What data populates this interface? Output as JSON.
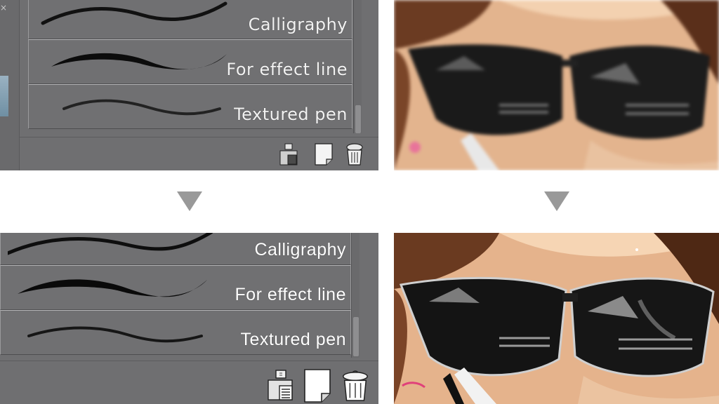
{
  "before_panel": {
    "brushes": [
      {
        "label": "Calligraphy"
      },
      {
        "label": "For effect line"
      },
      {
        "label": "Textured pen"
      }
    ],
    "toolbar": {
      "icons": [
        "brush-settings-icon",
        "new-page-icon",
        "trash-icon"
      ]
    }
  },
  "after_panel": {
    "brushes": [
      {
        "label": "Calligraphy"
      },
      {
        "label": "For effect line"
      },
      {
        "label": "Textured pen"
      }
    ],
    "toolbar": {
      "icons": [
        "brush-settings-icon",
        "new-page-icon",
        "trash-icon"
      ]
    }
  },
  "arrows": [
    "down-arrow",
    "down-arrow"
  ],
  "colors": {
    "panel_bg": "#6f6f71",
    "arrow": "#999999",
    "label": "#ffffff"
  }
}
